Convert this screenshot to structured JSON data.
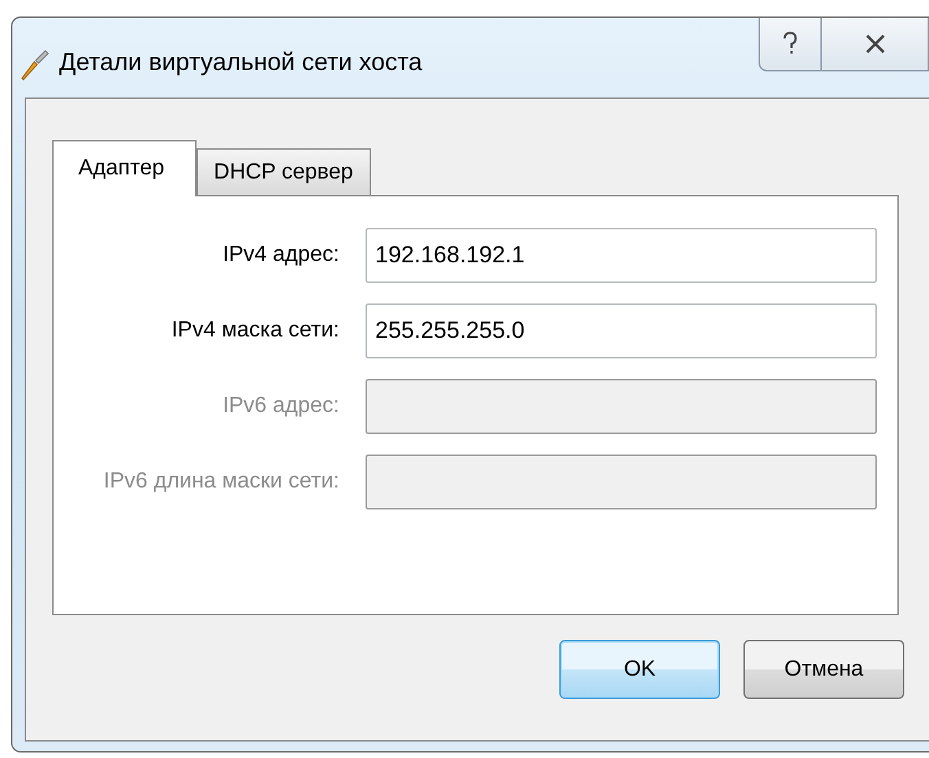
{
  "window": {
    "title": "Детали виртуальной сети хоста"
  },
  "tabs": [
    {
      "label": "Адаптер",
      "selected": true
    },
    {
      "label": "DHCP сервер",
      "selected": false
    }
  ],
  "fields": [
    {
      "label": "IPv4 адрес:",
      "value": "192.168.192.1",
      "disabled": false
    },
    {
      "label": "IPv4 маска сети:",
      "value": "255.255.255.0",
      "disabled": false
    },
    {
      "label": "IPv6 адрес:",
      "disabled": true
    },
    {
      "label": "IPv6 длина маски сети:",
      "disabled": true
    }
  ],
  "buttons": [
    {
      "label": "OK",
      "default": true
    },
    {
      "label": "Отмена",
      "default": false
    }
  ]
}
